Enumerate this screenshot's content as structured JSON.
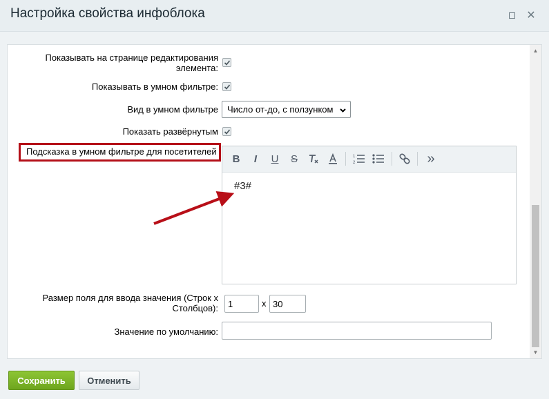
{
  "dialog": {
    "title": "Настройка свойства инфоблока"
  },
  "form": {
    "show_on_edit_label_line1": "Показывать на странице редактирования",
    "show_on_edit_label_line2": "элемента:",
    "show_on_edit_checked": true,
    "show_in_smart_filter_label": "Показывать в умном фильтре:",
    "show_in_smart_filter_checked": true,
    "smart_filter_view_label": "Вид в умном фильтре",
    "smart_filter_view_value": "Число от-до, с ползунком",
    "show_expanded_label": "Показать развёрнутым",
    "show_expanded_checked": true,
    "hint_label": "Подсказка в умном фильтре для посетителей",
    "hint_editor_text": "#3#",
    "field_size_label_line1": "Размер поля для ввода значения (Строк х",
    "field_size_label_line2": "Столбцов):",
    "rows_value": "1",
    "size_separator": "x",
    "cols_value": "30",
    "default_value_label": "Значение по умолчанию:",
    "default_value": ""
  },
  "editor_toolbar": {
    "bold": "B",
    "italic": "I",
    "underline": "U",
    "strike": "S",
    "more": "»"
  },
  "footer": {
    "save_label": "Сохранить",
    "cancel_label": "Отменить"
  },
  "colors": {
    "highlight": "#b40f18",
    "save_button": "#7bb525",
    "arrow": "#b80f18"
  }
}
